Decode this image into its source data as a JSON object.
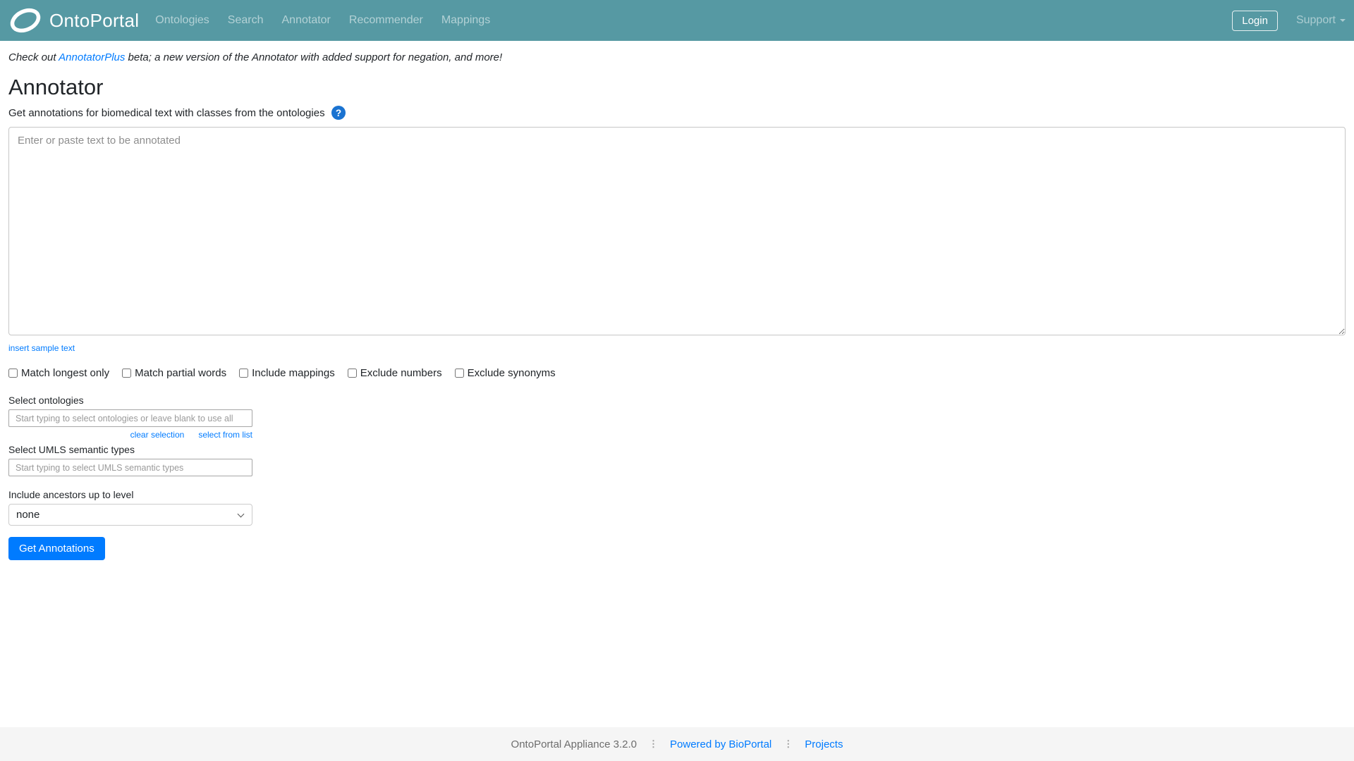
{
  "navbar": {
    "brand": "OntoPortal",
    "items": [
      {
        "label": "Ontologies"
      },
      {
        "label": "Search"
      },
      {
        "label": "Annotator"
      },
      {
        "label": "Recommender"
      },
      {
        "label": "Mappings"
      }
    ],
    "login_label": "Login",
    "support_label": "Support"
  },
  "notice": {
    "prefix": "Check out ",
    "link": "AnnotatorPlus",
    "suffix": " beta; a new version of the Annotator with added support for negation, and more!"
  },
  "page": {
    "title": "Annotator",
    "subtitle": "Get annotations for biomedical text with classes from the ontologies"
  },
  "annotator_form": {
    "text_placeholder": "Enter or paste text to be annotated",
    "insert_sample_label": "insert sample text",
    "checkboxes": [
      {
        "label": "Match longest only",
        "checked": false
      },
      {
        "label": "Match partial words",
        "checked": false
      },
      {
        "label": "Include mappings",
        "checked": false
      },
      {
        "label": "Exclude numbers",
        "checked": false
      },
      {
        "label": "Exclude synonyms",
        "checked": false
      }
    ],
    "ontologies": {
      "label": "Select ontologies",
      "placeholder": "Start typing to select ontologies or leave blank to use all",
      "clear_label": "clear selection",
      "select_from_list_label": "select from list"
    },
    "umls": {
      "label": "Select UMLS semantic types",
      "placeholder": "Start typing to select UMLS semantic types"
    },
    "ancestors": {
      "label": "Include ancestors up to level",
      "selected": "none"
    },
    "submit_label": "Get Annotations"
  },
  "footer": {
    "appliance_text": "OntoPortal Appliance 3.2.0",
    "separator": "⋮",
    "powered_by_label": "Powered by BioPortal",
    "projects_label": "Projects"
  },
  "colors": {
    "navbar_bg": "#5699a3",
    "accent_blue": "#007bff",
    "help_blue": "#1a73d1",
    "footer_bg": "#f5f5f5"
  }
}
